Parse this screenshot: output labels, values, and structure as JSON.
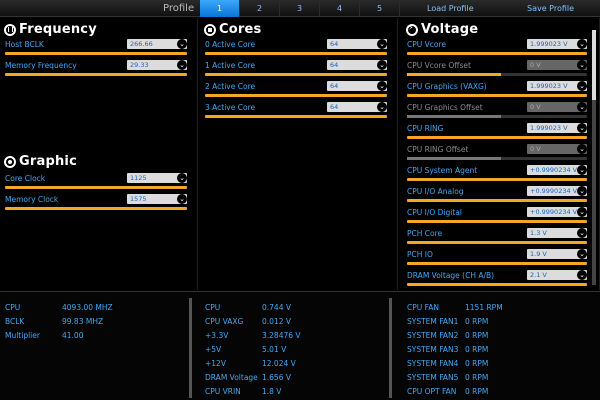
{
  "topbar": {
    "profile_label": "Profile",
    "tabs": [
      "1",
      "2",
      "3",
      "4",
      "5"
    ],
    "load_label": "Load Profile",
    "save_label": "Save Profile"
  },
  "frequency": {
    "title": "Frequency",
    "rows": [
      {
        "label": "Host BCLK",
        "value": "266.66"
      },
      {
        "label": "Memory Frequency",
        "value": "29.33"
      }
    ]
  },
  "graphic": {
    "title": "Graphic",
    "rows": [
      {
        "label": "Core Clock",
        "value": "1125"
      },
      {
        "label": "Memory Clock",
        "value": "1575"
      }
    ]
  },
  "cores": {
    "title": "Cores",
    "rows": [
      {
        "label": "0 Active Core",
        "value": "64"
      },
      {
        "label": "1 Active Core",
        "value": "64"
      },
      {
        "label": "2 Active Core",
        "value": "64"
      },
      {
        "label": "3 Active Core",
        "value": "64"
      }
    ]
  },
  "voltage": {
    "title": "Voltage",
    "rows": [
      {
        "label": "CPU Vcore",
        "value": "1.999023 V"
      },
      {
        "label": "CPU Vcore Offset",
        "value": "0 V"
      },
      {
        "label": "CPU Graphics (VAXG)",
        "value": "1.999023 V"
      },
      {
        "label": "CPU Graphics Offset",
        "value": "0 V"
      },
      {
        "label": "CPU RING",
        "value": "1.999023 V"
      },
      {
        "label": "CPU RING Offset",
        "value": "0 V"
      },
      {
        "label": "CPU System Agent",
        "value": "+0.9990234 V"
      },
      {
        "label": "CPU I/O Analog",
        "value": "+0.9990234 V"
      },
      {
        "label": "CPU I/O Digital",
        "value": "+0.9990234 V"
      },
      {
        "label": "PCH Core",
        "value": "1.3 V"
      },
      {
        "label": "PCH IO",
        "value": "1.9 V"
      },
      {
        "label": "DRAM Voltage (CH A/B)",
        "value": "2.1 V"
      }
    ]
  },
  "monitor": {
    "col1": [
      {
        "k": "CPU",
        "v": "4093.00 MHZ"
      },
      {
        "k": "BCLK",
        "v": "99.83 MHZ"
      },
      {
        "k": "Multiplier",
        "v": "41.00"
      }
    ],
    "col2": [
      {
        "k": "CPU",
        "v": "0.744 V"
      },
      {
        "k": "CPU VAXG",
        "v": "0.012 V"
      },
      {
        "k": "+3.3V",
        "v": "3.28476 V"
      },
      {
        "k": "+5V",
        "v": "5.01 V"
      },
      {
        "k": "+12V",
        "v": "12.024 V"
      },
      {
        "k": "DRAM Voltage",
        "v": "1.656 V"
      },
      {
        "k": "CPU VRIN",
        "v": "1.8 V"
      }
    ],
    "col3": [
      {
        "k": "CPU FAN",
        "v": "1151 RPM"
      },
      {
        "k": "SYSTEM FAN1",
        "v": "0 RPM"
      },
      {
        "k": "SYSTEM FAN2",
        "v": "0 RPM"
      },
      {
        "k": "SYSTEM FAN3",
        "v": "0 RPM"
      },
      {
        "k": "SYSTEM FAN4",
        "v": "0 RPM"
      },
      {
        "k": "SYSTEM FAN5",
        "v": "0 RPM"
      },
      {
        "k": "CPU OPT FAN",
        "v": "0 RPM"
      }
    ]
  },
  "colors": {
    "accent": "#3fa9f5",
    "bar": "#f5a623",
    "tab_active": "#1e8ef0"
  },
  "icons": {
    "dropdown": "chevron-down-icon"
  }
}
